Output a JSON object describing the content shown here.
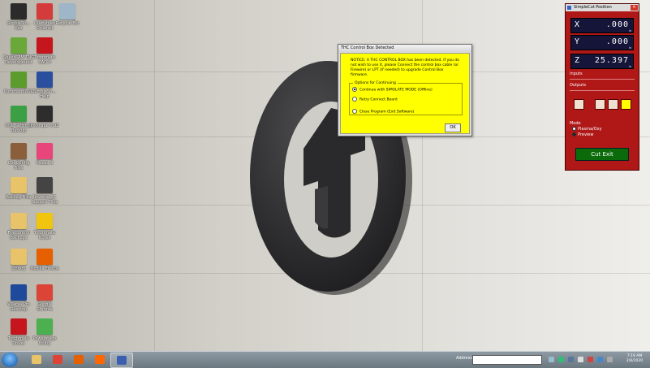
{
  "desktop_icons": [
    {
      "label": "SimpleSh... Res",
      "color": "#2b2b2b"
    },
    {
      "label": "Craftsman Ordered",
      "color": "#d43b3b"
    },
    {
      "label": "Recycle Bin",
      "color": "#9fb5c8"
    },
    {
      "label": "SheetCAM TNG Development",
      "color": "#6aa83a"
    },
    {
      "label": "Torchmate CAD 9",
      "color": "#c4161c"
    },
    {
      "label": "CommandCNC",
      "color": "#5c9c2c"
    },
    {
      "label": "SimpleSh... Help",
      "color": "#2a4f9e"
    },
    {
      "label": "CNC Settings Backup",
      "color": "#3aa043"
    },
    {
      "label": "Inkscape 0.92",
      "color": "#2d2d2d"
    },
    {
      "label": "Cut Config Files",
      "color": "#8b5e3c"
    },
    {
      "label": "Picasa 3",
      "color": "#e8457a"
    },
    {
      "label": "Backup Files",
      "color": "#e8c36a"
    },
    {
      "label": "Reverse SC Support Files",
      "color": "#444444"
    },
    {
      "label": "FireControl Backups",
      "color": "#e8c36a"
    },
    {
      "label": "Torchmate Notes",
      "color": "#f1c40f"
    },
    {
      "label": "Library",
      "color": "#e8c36a"
    },
    {
      "label": "Mozilla Firefox",
      "color": "#e66000"
    },
    {
      "label": "VCarve Pro Desktop",
      "color": "#1f4a9c"
    },
    {
      "label": "Google Chrome",
      "color": "#db4437"
    },
    {
      "label": "Torchmate Driver",
      "color": "#c4161c"
    },
    {
      "label": "Powerstage Utility",
      "color": "#4caf50"
    }
  ],
  "dialog": {
    "title": "THC Control Box Detected",
    "message": "NOTICE: A THC CONTROL BOX has been detected. If you do not wish to use it, please Connect the control box cable (or Firewire) or LPT (if needed) to upgrade Control Box firmware.",
    "group_label": "Options for Continuing",
    "options": [
      {
        "label": "Continue with SIMULATE MODE (Offline)",
        "selected": true
      },
      {
        "label": "Retry Connect Board",
        "selected": false
      },
      {
        "label": "Close Program (Exit Software)",
        "selected": false
      }
    ],
    "ok_label": "OK"
  },
  "dro": {
    "title": "SimpleCut Position",
    "axes": [
      {
        "name": "X",
        "value": ".000",
        "unit": "in"
      },
      {
        "name": "Y",
        "value": ".000",
        "unit": "in"
      },
      {
        "name": "Z",
        "value": "25.397",
        "unit": "in"
      }
    ],
    "inputs_label": "Inputs",
    "outputs_label": "Outputs",
    "mode_label": "Mode",
    "modes": [
      {
        "label": "Plasma/Oxy",
        "selected": false
      },
      {
        "label": "Preview",
        "selected": true
      }
    ],
    "cut_button": "Cut Exit",
    "colors": {
      "panel": "#b01818",
      "readout": "#15153a",
      "cut_button": "#0b6b0b"
    }
  },
  "taskbar": {
    "search_label": "Address",
    "clock": {
      "time": "7:19 AM",
      "date": "2/8/2020"
    },
    "apps": [
      {
        "name": "file-explorer-icon",
        "color": "#e8c36a"
      },
      {
        "name": "chrome-icon",
        "color": "#db4437"
      },
      {
        "name": "firefox-icon",
        "color": "#e66000"
      },
      {
        "name": "mi-icon",
        "color": "#ff6700"
      },
      {
        "name": "simplecut-icon",
        "color": "#3a5fb0"
      }
    ]
  }
}
